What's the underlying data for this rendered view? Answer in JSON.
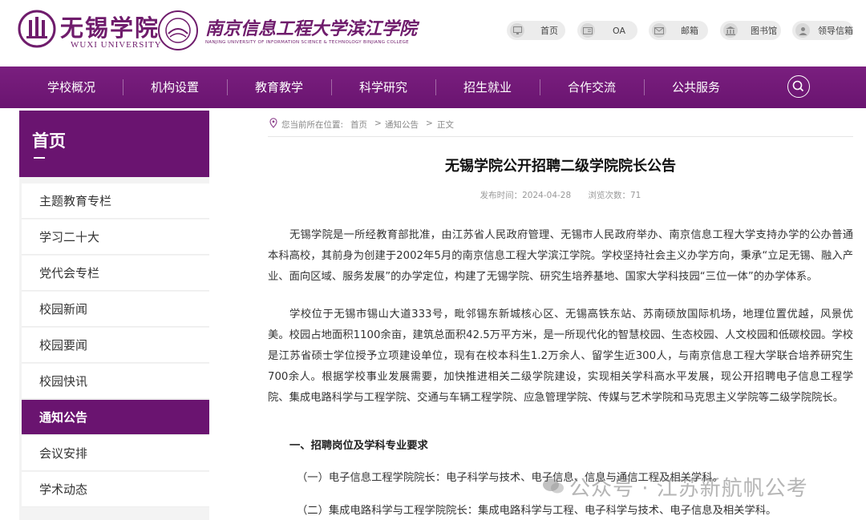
{
  "header": {
    "logo_text": "无锡学院",
    "logo_en": "WUXI UNIVERSITY",
    "logo2_text": "南京信息工程大学滨江学院",
    "logo2_en": "NANJING UNIVERSITY OF INFORMATION SCIENCE & TECHNOLOGY BINJIANG COLLEGE",
    "quick_links": [
      "首页",
      "OA",
      "邮箱",
      "图书馆",
      "领导信箱"
    ]
  },
  "nav": {
    "items": [
      "学校概况",
      "机构设置",
      "教育教学",
      "科学研究",
      "招生就业",
      "合作交流",
      "公共服务"
    ]
  },
  "sidebar": {
    "title": "首页",
    "items": [
      "主题教育专栏",
      "学习二十大",
      "党代会专栏",
      "校园新闻",
      "校园要闻",
      "校园快讯",
      "通知公告",
      "会议安排",
      "学术动态"
    ],
    "active": "通知公告"
  },
  "breadcrumb": {
    "prefix": "您当前所在位置:",
    "items": [
      "首页",
      "通知公告",
      "正文"
    ],
    "sep": ">"
  },
  "article": {
    "title": "无锡学院公开招聘二级学院院长公告",
    "date": "发布时间：2024-04-28",
    "views": "浏览次数：71",
    "p1": "无锡学院是一所经教育部批准，由江苏省人民政府管理、无锡市人民政府举办、南京信息工程大学支持办学的公办普通本科高校，其前身为创建于2002年5月的南京信息工程大学滨江学院。学校坚持社会主义办学方向，秉承“立足无锡、融入产业、面向区域、服务发展”的办学定位，构建了无锡学院、研究生培养基地、国家大学科技园“三位一体”的办学体系。",
    "p2": "学校位于无锡市锡山大道333号，毗邻锡东新城核心区、无锡高铁东站、苏南硕放国际机场，地理位置优越，风景优美。校园占地面积1100余亩，建筑总面积42.5万平方米，是一所现代化的智慧校园、生态校园、人文校园和低碳校园。学校是江苏省硕士学位授予立项建设单位，现有在校本科生1.2万余人、留学生近300人，与南京信息工程大学联合培养研究生700余人。根据学校事业发展需要，加快推进相关二级学院建设，实现相关学科高水平发展，现公开招聘电子信息工程学院、集成电路科学与工程学院、交通与车辆工程学院、应急管理学院、传媒与艺术学院和马克思主义学院等二级学院院长。",
    "h1": "一、招聘岗位及学科专业要求",
    "i1": "（一）电子信息工程学院院长：电子科学与技术、电子信息、信息与通信工程及相关学科。",
    "i2": "（二）集成电路科学与工程学院院长：集成电路科学与工程、电子科学与技术、电子信息及相关学科。"
  },
  "watermark": "公众号 · 江苏新航帆公考",
  "colors": {
    "brand": "#6a1470"
  }
}
